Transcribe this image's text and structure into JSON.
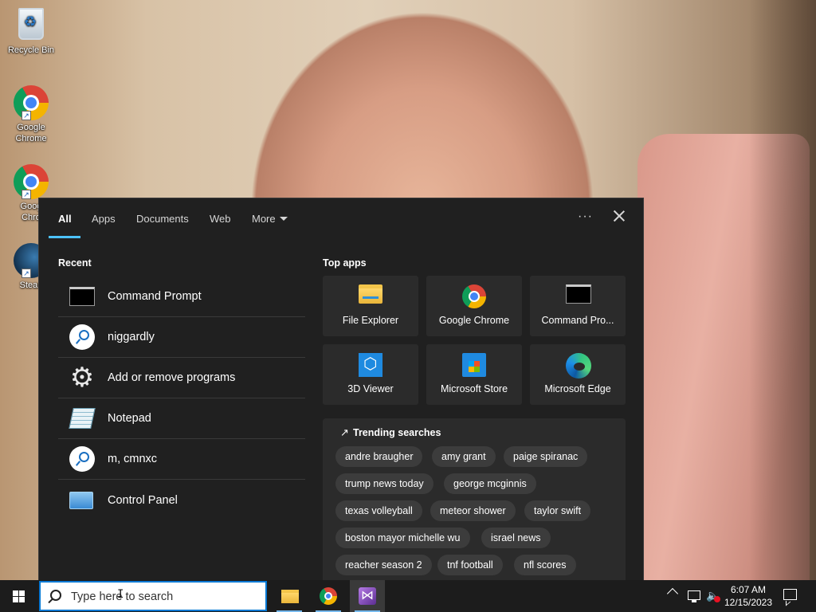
{
  "desktop": {
    "icons": [
      {
        "label": "Recycle Bin",
        "icon": "recycle-bin-icon"
      },
      {
        "label": "Google\nChrome",
        "icon": "chrome-icon"
      },
      {
        "label": "Goog\nChro",
        "icon": "chrome-icon"
      },
      {
        "label": "Stean",
        "icon": "steam-icon"
      }
    ]
  },
  "search_flyout": {
    "tabs": [
      {
        "label": "All",
        "active": true
      },
      {
        "label": "Apps"
      },
      {
        "label": "Documents"
      },
      {
        "label": "Web"
      },
      {
        "label": "More"
      }
    ],
    "more_options_label": "···",
    "recent": {
      "title": "Recent",
      "items": [
        {
          "label": "Command Prompt",
          "icon": "command-prompt-icon"
        },
        {
          "label": "niggardly",
          "icon": "search-history-icon"
        },
        {
          "label": "Add or remove programs",
          "icon": "gear-icon"
        },
        {
          "label": "Notepad",
          "icon": "notepad-icon"
        },
        {
          "label": "m, cmnxc",
          "icon": "search-history-icon"
        },
        {
          "label": "Control Panel",
          "icon": "control-panel-icon"
        }
      ]
    },
    "top_apps": {
      "title": "Top apps",
      "items": [
        {
          "label": "File Explorer",
          "icon": "file-explorer-icon"
        },
        {
          "label": "Google Chrome",
          "icon": "chrome-icon"
        },
        {
          "label": "Command Pro...",
          "icon": "command-prompt-icon"
        },
        {
          "label": "3D Viewer",
          "icon": "3d-viewer-icon"
        },
        {
          "label": "Microsoft Store",
          "icon": "microsoft-store-icon"
        },
        {
          "label": "Microsoft Edge",
          "icon": "edge-icon"
        }
      ]
    },
    "trending": {
      "title": "Trending searches",
      "chips": [
        "andre braugher",
        "amy grant",
        "paige spiranac",
        "trump news today",
        "george mcginnis",
        "texas volleyball",
        "meteor shower",
        "taylor swift",
        "boston mayor michelle wu",
        "israel news",
        "reacher season 2",
        "tnf football",
        "nfl scores"
      ]
    }
  },
  "taskbar": {
    "search": {
      "placeholder": "Type here to search"
    },
    "apps": [
      {
        "name": "file-explorer"
      },
      {
        "name": "google-chrome"
      },
      {
        "name": "visual-studio-installer"
      }
    ],
    "clock": {
      "time": "6:07 AM",
      "date": "12/15/2023"
    }
  },
  "colors": {
    "flyout_bg": "#202020",
    "tile_bg": "#2b2b2b",
    "chip_bg": "#3c3c3c",
    "accent": "#4cc2ff",
    "taskbar_bg": "#1c1c1c",
    "search_border": "#0078d4"
  }
}
